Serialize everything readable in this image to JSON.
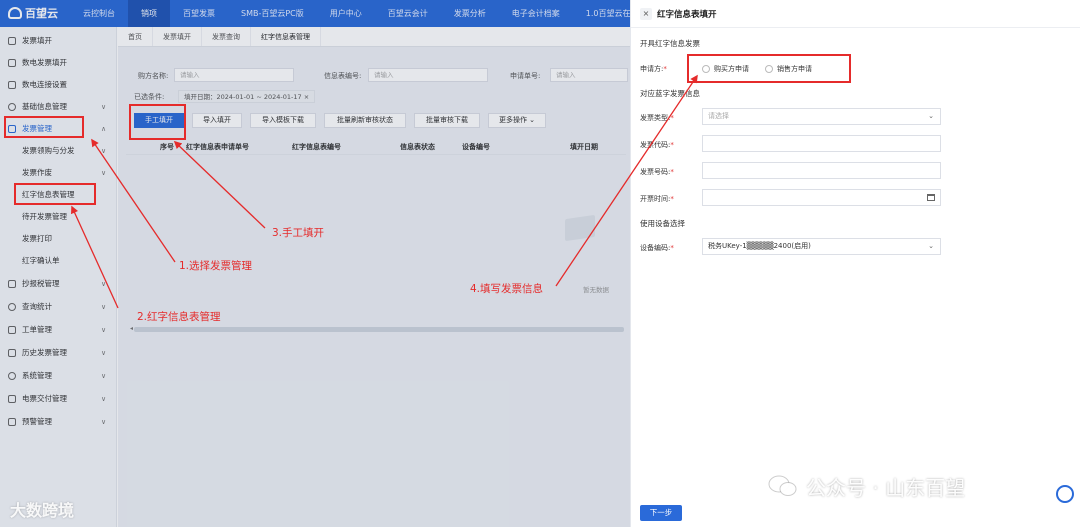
{
  "app": {
    "logo_text": "百望云"
  },
  "topnav": {
    "items": [
      "云控制台",
      "销项",
      "百望发票",
      "SMB-百望云PC版",
      "用户中心",
      "百望云会计",
      "发票分析",
      "电子会计档案",
      "1.0百望云在"
    ],
    "active_index": 1
  },
  "sidebar": {
    "items": [
      {
        "label": "发票填开",
        "chevron": ""
      },
      {
        "label": "数电发票填开",
        "chevron": ""
      },
      {
        "label": "数电连接设置",
        "chevron": ""
      },
      {
        "label": "基础信息管理",
        "chevron": "∨"
      },
      {
        "label": "发票管理",
        "chevron": "∧"
      },
      {
        "label": "发票领购与分发",
        "chevron": "∨"
      },
      {
        "label": "发票作废",
        "chevron": "∨"
      },
      {
        "label": "红字信息表管理",
        "chevron": ""
      },
      {
        "label": "待开发票管理",
        "chevron": ""
      },
      {
        "label": "发票打印",
        "chevron": ""
      },
      {
        "label": "红字确认单",
        "chevron": ""
      },
      {
        "label": "抄报税管理",
        "chevron": "∨"
      },
      {
        "label": "查询统计",
        "chevron": "∨"
      },
      {
        "label": "工单管理",
        "chevron": "∨"
      },
      {
        "label": "历史发票管理",
        "chevron": "∨"
      },
      {
        "label": "系统管理",
        "chevron": "∨"
      },
      {
        "label": "电票交付管理",
        "chevron": "∨"
      },
      {
        "label": "预警管理",
        "chevron": "∨"
      }
    ]
  },
  "tabs": [
    "首页",
    "发票填开",
    "发票查询",
    "红字信息表管理"
  ],
  "filters": {
    "buyer_label": "购方名称:",
    "buyer_placeholder": "请输入",
    "info_label": "信息表编号:",
    "info_placeholder": "请输入",
    "apply_label": "申请单号:",
    "apply_placeholder": "请输入"
  },
  "conditions": {
    "label": "已选条件:",
    "tag": "填开日期：2024-01-01 ~ 2024-01-17 ×"
  },
  "toolbar": [
    "手工填开",
    "导入填开",
    "导入模板下载",
    "批量刷新审核状态",
    "批量审核下载",
    "更多操作 ⌄"
  ],
  "table": {
    "headers": [
      "序号",
      "红字信息表申请单号",
      "红字信息表编号",
      "信息表状态",
      "设备编号",
      "填开日期"
    ],
    "empty_text": "暂无数据"
  },
  "drawer": {
    "title": "红字信息表填开",
    "section1": "开具红字信息发票",
    "applicant_label": "申请方:",
    "radio_buyer": "购买方申请",
    "radio_seller": "销售方申请",
    "section2": "对应蓝字发票信息",
    "invoice_type_label": "发票类型:",
    "invoice_type_placeholder": "请选择",
    "invoice_code_label": "发票代码:",
    "invoice_number_label": "发票号码:",
    "issue_time_label": "开票时间:",
    "section3": "使用设备选择",
    "device_label": "设备编码:",
    "device_value": "税务UKey-1▒▒▒▒▒2400(启用)",
    "next_button": "下一步",
    "required_mark": "*"
  },
  "annotations": {
    "step1": "1.选择发票管理",
    "step2": "2.红字信息表管理",
    "step3": "3.手工填开",
    "step4": "4.填写发票信息"
  },
  "watermarks": {
    "left": "大数跨境",
    "right": "公众号 · 山东百望"
  },
  "colors": {
    "brand_blue": "#2a6ad9",
    "annotation_red": "#e52b2b"
  }
}
